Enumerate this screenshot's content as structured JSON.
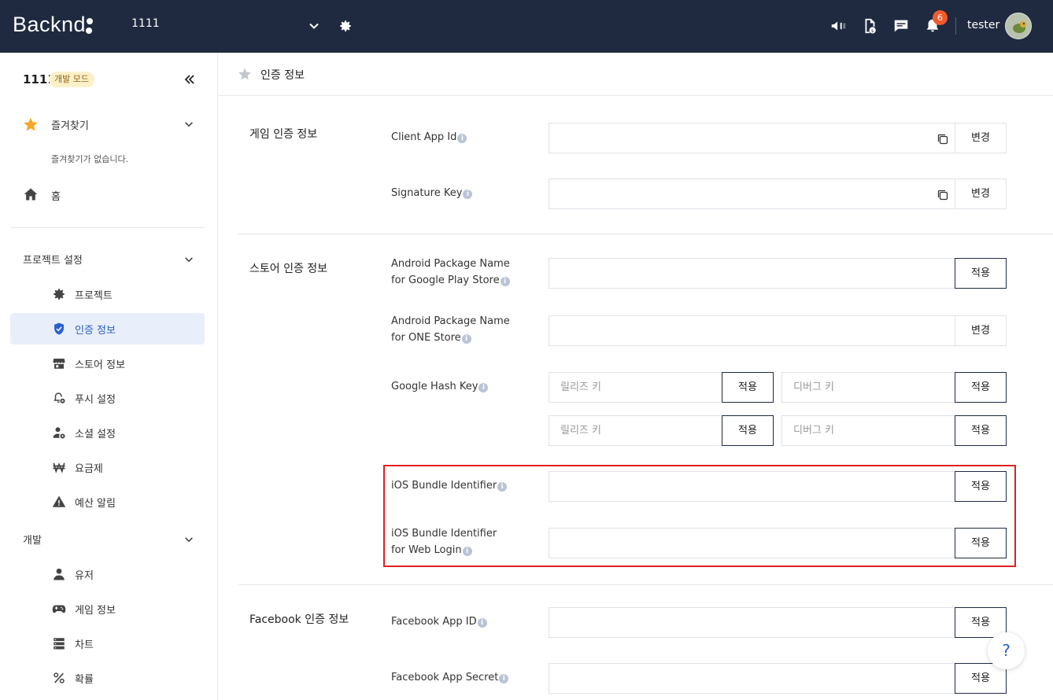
{
  "topbar": {
    "logo": "Backnd",
    "project": "1111",
    "username": "tester",
    "notification_count": "6",
    "icons": [
      "megaphone-icon",
      "document-dollar-icon",
      "chat-icon",
      "bell-icon"
    ]
  },
  "sidebar": {
    "project_name": "1111",
    "mode_badge": "개발 모드",
    "favorites_label": "즐겨찾기",
    "favorites_empty": "즐겨찾기가 없습니다.",
    "home_label": "홈",
    "section_project": "프로젝트 설정",
    "section_dev": "개발",
    "project_items": [
      {
        "label": "프로젝트",
        "icon": "gear-icon"
      },
      {
        "label": "인증 정보",
        "icon": "shield-check-icon"
      },
      {
        "label": "스토어 정보",
        "icon": "store-icon"
      },
      {
        "label": "푸시 설정",
        "icon": "bell-gear-icon"
      },
      {
        "label": "소셜 설정",
        "icon": "user-gear-icon"
      },
      {
        "label": "요금제",
        "icon": "won-icon"
      },
      {
        "label": "예산 알림",
        "icon": "warning-icon"
      }
    ],
    "dev_items": [
      {
        "label": "유저",
        "icon": "user-icon"
      },
      {
        "label": "게임 정보",
        "icon": "gamepad-icon"
      },
      {
        "label": "차트",
        "icon": "server-icon"
      },
      {
        "label": "확률",
        "icon": "percent-icon"
      }
    ]
  },
  "main": {
    "page_title": "인증 정보",
    "sections": {
      "game": "게임 인증 정보",
      "store": "스토어 인증 정보",
      "facebook": "Facebook 인증 정보"
    },
    "fields": {
      "client_app_id": "Client App Id",
      "signature_key": "Signature Key",
      "android_google_1": "Android Package Name",
      "android_google_2": "for Google Play Store",
      "android_one_1": "Android Package Name",
      "android_one_2": "for ONE Store",
      "google_hash_key": "Google Hash Key",
      "ios_bundle": "iOS Bundle Identifier",
      "ios_web_1": "iOS Bundle Identifier",
      "ios_web_2": "for Web Login",
      "fb_app_id": "Facebook App ID",
      "fb_app_secret": "Facebook App Secret"
    },
    "buttons": {
      "change": "변경",
      "apply": "적용"
    },
    "placeholders": {
      "release_key": "릴리즈 키",
      "debug_key": "디버그 키"
    },
    "help": "?"
  }
}
